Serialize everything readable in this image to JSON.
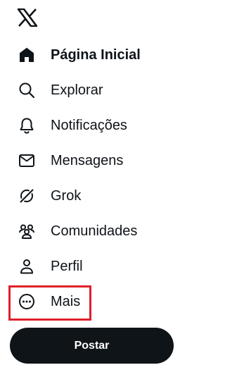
{
  "brand": {
    "logo_icon": "x-logo-icon"
  },
  "nav": {
    "items": [
      {
        "label": "Página Inicial",
        "icon": "home-icon",
        "active": true
      },
      {
        "label": "Explorar",
        "icon": "search-icon",
        "active": false
      },
      {
        "label": "Notificações",
        "icon": "bell-icon",
        "active": false
      },
      {
        "label": "Mensagens",
        "icon": "envelope-icon",
        "active": false
      },
      {
        "label": "Grok",
        "icon": "grok-icon",
        "active": false
      },
      {
        "label": "Comunidades",
        "icon": "communities-icon",
        "active": false
      },
      {
        "label": "Perfil",
        "icon": "person-icon",
        "active": false
      },
      {
        "label": "Mais",
        "icon": "more-circle-icon",
        "active": false
      }
    ]
  },
  "post_button": {
    "label": "Postar"
  },
  "colors": {
    "text": "#0f1419",
    "highlight": "#e0202a",
    "button_bg": "#0f1419",
    "button_text": "#ffffff"
  }
}
